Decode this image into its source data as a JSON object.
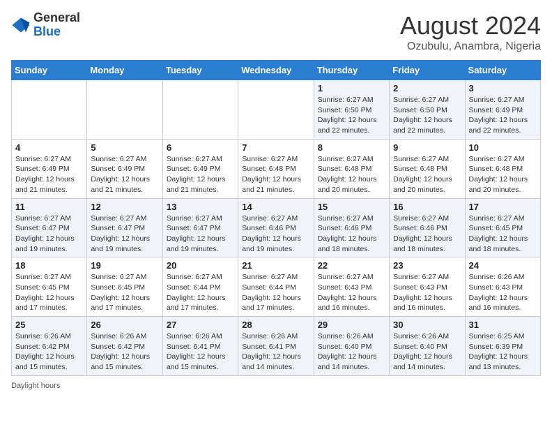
{
  "header": {
    "logo_general": "General",
    "logo_blue": "Blue",
    "month_year": "August 2024",
    "location": "Ozubulu, Anambra, Nigeria"
  },
  "days_of_week": [
    "Sunday",
    "Monday",
    "Tuesday",
    "Wednesday",
    "Thursday",
    "Friday",
    "Saturday"
  ],
  "weeks": [
    [
      {
        "day": "",
        "info": ""
      },
      {
        "day": "",
        "info": ""
      },
      {
        "day": "",
        "info": ""
      },
      {
        "day": "",
        "info": ""
      },
      {
        "day": "1",
        "info": "Sunrise: 6:27 AM\nSunset: 6:50 PM\nDaylight: 12 hours\nand 22 minutes."
      },
      {
        "day": "2",
        "info": "Sunrise: 6:27 AM\nSunset: 6:50 PM\nDaylight: 12 hours\nand 22 minutes."
      },
      {
        "day": "3",
        "info": "Sunrise: 6:27 AM\nSunset: 6:49 PM\nDaylight: 12 hours\nand 22 minutes."
      }
    ],
    [
      {
        "day": "4",
        "info": "Sunrise: 6:27 AM\nSunset: 6:49 PM\nDaylight: 12 hours\nand 21 minutes."
      },
      {
        "day": "5",
        "info": "Sunrise: 6:27 AM\nSunset: 6:49 PM\nDaylight: 12 hours\nand 21 minutes."
      },
      {
        "day": "6",
        "info": "Sunrise: 6:27 AM\nSunset: 6:49 PM\nDaylight: 12 hours\nand 21 minutes."
      },
      {
        "day": "7",
        "info": "Sunrise: 6:27 AM\nSunset: 6:48 PM\nDaylight: 12 hours\nand 21 minutes."
      },
      {
        "day": "8",
        "info": "Sunrise: 6:27 AM\nSunset: 6:48 PM\nDaylight: 12 hours\nand 20 minutes."
      },
      {
        "day": "9",
        "info": "Sunrise: 6:27 AM\nSunset: 6:48 PM\nDaylight: 12 hours\nand 20 minutes."
      },
      {
        "day": "10",
        "info": "Sunrise: 6:27 AM\nSunset: 6:48 PM\nDaylight: 12 hours\nand 20 minutes."
      }
    ],
    [
      {
        "day": "11",
        "info": "Sunrise: 6:27 AM\nSunset: 6:47 PM\nDaylight: 12 hours\nand 19 minutes."
      },
      {
        "day": "12",
        "info": "Sunrise: 6:27 AM\nSunset: 6:47 PM\nDaylight: 12 hours\nand 19 minutes."
      },
      {
        "day": "13",
        "info": "Sunrise: 6:27 AM\nSunset: 6:47 PM\nDaylight: 12 hours\nand 19 minutes."
      },
      {
        "day": "14",
        "info": "Sunrise: 6:27 AM\nSunset: 6:46 PM\nDaylight: 12 hours\nand 19 minutes."
      },
      {
        "day": "15",
        "info": "Sunrise: 6:27 AM\nSunset: 6:46 PM\nDaylight: 12 hours\nand 18 minutes."
      },
      {
        "day": "16",
        "info": "Sunrise: 6:27 AM\nSunset: 6:46 PM\nDaylight: 12 hours\nand 18 minutes."
      },
      {
        "day": "17",
        "info": "Sunrise: 6:27 AM\nSunset: 6:45 PM\nDaylight: 12 hours\nand 18 minutes."
      }
    ],
    [
      {
        "day": "18",
        "info": "Sunrise: 6:27 AM\nSunset: 6:45 PM\nDaylight: 12 hours\nand 17 minutes."
      },
      {
        "day": "19",
        "info": "Sunrise: 6:27 AM\nSunset: 6:45 PM\nDaylight: 12 hours\nand 17 minutes."
      },
      {
        "day": "20",
        "info": "Sunrise: 6:27 AM\nSunset: 6:44 PM\nDaylight: 12 hours\nand 17 minutes."
      },
      {
        "day": "21",
        "info": "Sunrise: 6:27 AM\nSunset: 6:44 PM\nDaylight: 12 hours\nand 17 minutes."
      },
      {
        "day": "22",
        "info": "Sunrise: 6:27 AM\nSunset: 6:43 PM\nDaylight: 12 hours\nand 16 minutes."
      },
      {
        "day": "23",
        "info": "Sunrise: 6:27 AM\nSunset: 6:43 PM\nDaylight: 12 hours\nand 16 minutes."
      },
      {
        "day": "24",
        "info": "Sunrise: 6:26 AM\nSunset: 6:43 PM\nDaylight: 12 hours\nand 16 minutes."
      }
    ],
    [
      {
        "day": "25",
        "info": "Sunrise: 6:26 AM\nSunset: 6:42 PM\nDaylight: 12 hours\nand 15 minutes."
      },
      {
        "day": "26",
        "info": "Sunrise: 6:26 AM\nSunset: 6:42 PM\nDaylight: 12 hours\nand 15 minutes."
      },
      {
        "day": "27",
        "info": "Sunrise: 6:26 AM\nSunset: 6:41 PM\nDaylight: 12 hours\nand 15 minutes."
      },
      {
        "day": "28",
        "info": "Sunrise: 6:26 AM\nSunset: 6:41 PM\nDaylight: 12 hours\nand 14 minutes."
      },
      {
        "day": "29",
        "info": "Sunrise: 6:26 AM\nSunset: 6:40 PM\nDaylight: 12 hours\nand 14 minutes."
      },
      {
        "day": "30",
        "info": "Sunrise: 6:26 AM\nSunset: 6:40 PM\nDaylight: 12 hours\nand 14 minutes."
      },
      {
        "day": "31",
        "info": "Sunrise: 6:25 AM\nSunset: 6:39 PM\nDaylight: 12 hours\nand 13 minutes."
      }
    ]
  ],
  "footer": {
    "daylight_label": "Daylight hours"
  }
}
